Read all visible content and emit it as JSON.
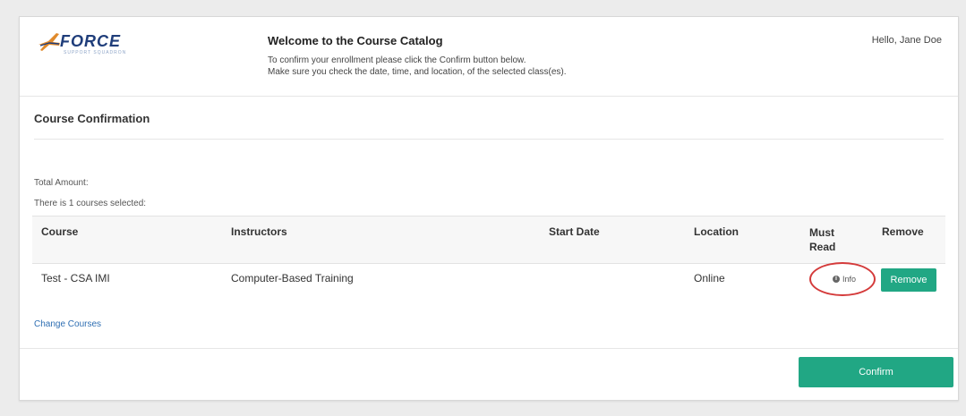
{
  "header": {
    "logo_text": "FORCE",
    "logo_subtext": "SUPPORT SQUADRON",
    "welcome_title": "Welcome to the Course Catalog",
    "welcome_line1": "To confirm your enrollment please click the Confirm button below.",
    "welcome_line2": "Make sure you check the date, time, and location, of the selected class(es).",
    "greeting": "Hello, Jane Doe"
  },
  "confirmation": {
    "section_title": "Course Confirmation",
    "total_amount_label": "Total Amount:",
    "courses_selected_text": "There is 1 courses selected:"
  },
  "table": {
    "columns": {
      "course": "Course",
      "instructors": "Instructors",
      "start_date": "Start Date",
      "location": "Location",
      "must_read_line1": "Must",
      "must_read_line2": "Read",
      "remove": "Remove"
    },
    "rows": [
      {
        "course": "Test - CSA IMI",
        "instructors": "Computer-Based Training",
        "start_date": "",
        "location": "Online",
        "info_label": "Info",
        "remove_label": "Remove"
      }
    ]
  },
  "links": {
    "change_courses": "Change Courses"
  },
  "actions": {
    "confirm_label": "Confirm"
  },
  "colors": {
    "accent_green": "#21a784",
    "link_blue": "#2f6fb3",
    "highlight_red": "#d43a3a",
    "logo_navy": "#1f3d7a"
  },
  "icons": {
    "logo": "jet-icon",
    "info": "info-circle-icon"
  }
}
